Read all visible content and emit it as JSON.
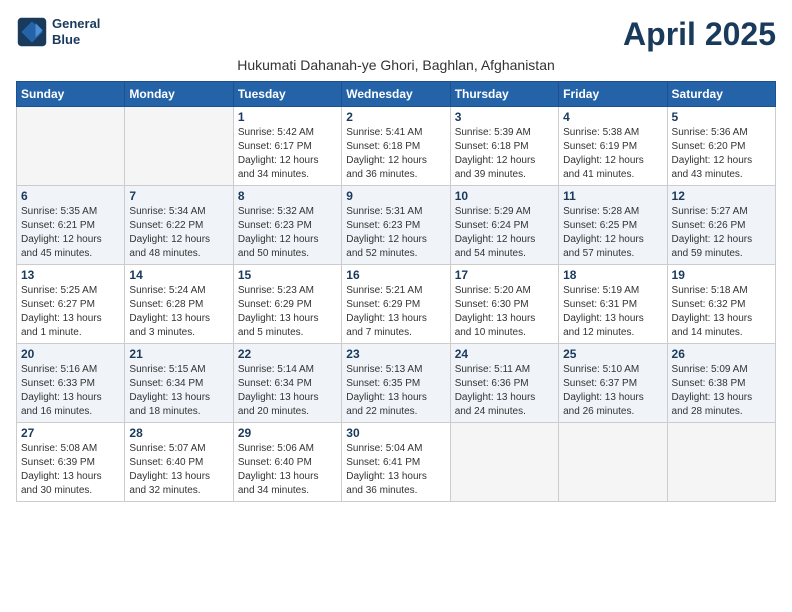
{
  "header": {
    "logo_line1": "General",
    "logo_line2": "Blue",
    "month_title": "April 2025",
    "subtitle": "Hukumati Dahanah-ye Ghori, Baghlan, Afghanistan"
  },
  "weekdays": [
    "Sunday",
    "Monday",
    "Tuesday",
    "Wednesday",
    "Thursday",
    "Friday",
    "Saturday"
  ],
  "weeks": [
    [
      {
        "day": "",
        "info": ""
      },
      {
        "day": "",
        "info": ""
      },
      {
        "day": "1",
        "info": "Sunrise: 5:42 AM\nSunset: 6:17 PM\nDaylight: 12 hours and 34 minutes."
      },
      {
        "day": "2",
        "info": "Sunrise: 5:41 AM\nSunset: 6:18 PM\nDaylight: 12 hours and 36 minutes."
      },
      {
        "day": "3",
        "info": "Sunrise: 5:39 AM\nSunset: 6:18 PM\nDaylight: 12 hours and 39 minutes."
      },
      {
        "day": "4",
        "info": "Sunrise: 5:38 AM\nSunset: 6:19 PM\nDaylight: 12 hours and 41 minutes."
      },
      {
        "day": "5",
        "info": "Sunrise: 5:36 AM\nSunset: 6:20 PM\nDaylight: 12 hours and 43 minutes."
      }
    ],
    [
      {
        "day": "6",
        "info": "Sunrise: 5:35 AM\nSunset: 6:21 PM\nDaylight: 12 hours and 45 minutes."
      },
      {
        "day": "7",
        "info": "Sunrise: 5:34 AM\nSunset: 6:22 PM\nDaylight: 12 hours and 48 minutes."
      },
      {
        "day": "8",
        "info": "Sunrise: 5:32 AM\nSunset: 6:23 PM\nDaylight: 12 hours and 50 minutes."
      },
      {
        "day": "9",
        "info": "Sunrise: 5:31 AM\nSunset: 6:23 PM\nDaylight: 12 hours and 52 minutes."
      },
      {
        "day": "10",
        "info": "Sunrise: 5:29 AM\nSunset: 6:24 PM\nDaylight: 12 hours and 54 minutes."
      },
      {
        "day": "11",
        "info": "Sunrise: 5:28 AM\nSunset: 6:25 PM\nDaylight: 12 hours and 57 minutes."
      },
      {
        "day": "12",
        "info": "Sunrise: 5:27 AM\nSunset: 6:26 PM\nDaylight: 12 hours and 59 minutes."
      }
    ],
    [
      {
        "day": "13",
        "info": "Sunrise: 5:25 AM\nSunset: 6:27 PM\nDaylight: 13 hours and 1 minute."
      },
      {
        "day": "14",
        "info": "Sunrise: 5:24 AM\nSunset: 6:28 PM\nDaylight: 13 hours and 3 minutes."
      },
      {
        "day": "15",
        "info": "Sunrise: 5:23 AM\nSunset: 6:29 PM\nDaylight: 13 hours and 5 minutes."
      },
      {
        "day": "16",
        "info": "Sunrise: 5:21 AM\nSunset: 6:29 PM\nDaylight: 13 hours and 7 minutes."
      },
      {
        "day": "17",
        "info": "Sunrise: 5:20 AM\nSunset: 6:30 PM\nDaylight: 13 hours and 10 minutes."
      },
      {
        "day": "18",
        "info": "Sunrise: 5:19 AM\nSunset: 6:31 PM\nDaylight: 13 hours and 12 minutes."
      },
      {
        "day": "19",
        "info": "Sunrise: 5:18 AM\nSunset: 6:32 PM\nDaylight: 13 hours and 14 minutes."
      }
    ],
    [
      {
        "day": "20",
        "info": "Sunrise: 5:16 AM\nSunset: 6:33 PM\nDaylight: 13 hours and 16 minutes."
      },
      {
        "day": "21",
        "info": "Sunrise: 5:15 AM\nSunset: 6:34 PM\nDaylight: 13 hours and 18 minutes."
      },
      {
        "day": "22",
        "info": "Sunrise: 5:14 AM\nSunset: 6:34 PM\nDaylight: 13 hours and 20 minutes."
      },
      {
        "day": "23",
        "info": "Sunrise: 5:13 AM\nSunset: 6:35 PM\nDaylight: 13 hours and 22 minutes."
      },
      {
        "day": "24",
        "info": "Sunrise: 5:11 AM\nSunset: 6:36 PM\nDaylight: 13 hours and 24 minutes."
      },
      {
        "day": "25",
        "info": "Sunrise: 5:10 AM\nSunset: 6:37 PM\nDaylight: 13 hours and 26 minutes."
      },
      {
        "day": "26",
        "info": "Sunrise: 5:09 AM\nSunset: 6:38 PM\nDaylight: 13 hours and 28 minutes."
      }
    ],
    [
      {
        "day": "27",
        "info": "Sunrise: 5:08 AM\nSunset: 6:39 PM\nDaylight: 13 hours and 30 minutes."
      },
      {
        "day": "28",
        "info": "Sunrise: 5:07 AM\nSunset: 6:40 PM\nDaylight: 13 hours and 32 minutes."
      },
      {
        "day": "29",
        "info": "Sunrise: 5:06 AM\nSunset: 6:40 PM\nDaylight: 13 hours and 34 minutes."
      },
      {
        "day": "30",
        "info": "Sunrise: 5:04 AM\nSunset: 6:41 PM\nDaylight: 13 hours and 36 minutes."
      },
      {
        "day": "",
        "info": ""
      },
      {
        "day": "",
        "info": ""
      },
      {
        "day": "",
        "info": ""
      }
    ]
  ]
}
